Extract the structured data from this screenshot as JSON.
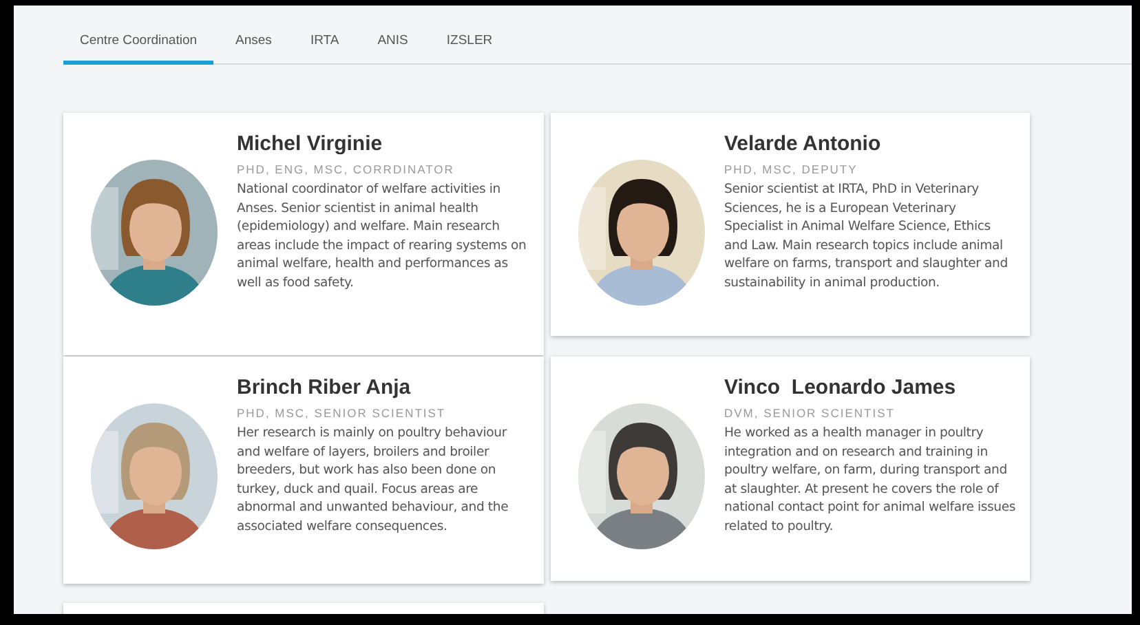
{
  "tabs": [
    {
      "label": "Centre Coordination",
      "selected": true
    },
    {
      "label": "Anses",
      "selected": false
    },
    {
      "label": "IRTA",
      "selected": false
    },
    {
      "label": "ANIS",
      "selected": false
    },
    {
      "label": "IZSLER",
      "selected": false
    }
  ],
  "people": [
    {
      "name": "Michel Virginie",
      "degrees": "PHD, ENG, MSC, CORRDINATOR",
      "bio": "National coordinator of welfare activities in Anses. Senior scientist in animal health (epidemiology) and welfare. Main research areas include the impact of rearing systems on animal welfare, health and performances as well as food safety."
    },
    {
      "name": "Velarde Antonio",
      "degrees": "PHD, MSC, DEPUTY",
      "bio": "Senior scientist at IRTA, PhD in Veterinary Sciences, he is a European Veterinary Specialist in Animal Welfare Science, Ethics and Law. Main research topics include animal welfare on farms, transport and slaughter and sustainability in animal production."
    },
    {
      "name": "Brinch Riber Anja",
      "degrees": "PHD, MSC, SENIOR SCIENTIST",
      "bio": "Her research is mainly on poultry behaviour and welfare of layers, broilers and broiler breeders, but work has also been done on turkey, duck and quail. Focus areas are abnormal and unwanted behaviour, and the associated welfare consequences."
    },
    {
      "name": "Vinco  Leonardo James",
      "degrees": "DVM, SENIOR SCIENTIST",
      "bio": "He worked as a health manager in poultry integration and on research and training in poultry welfare, on farm, during transport and at slaughter. At present he covers the role of national contact point for animal welfare issues related to poultry."
    }
  ]
}
